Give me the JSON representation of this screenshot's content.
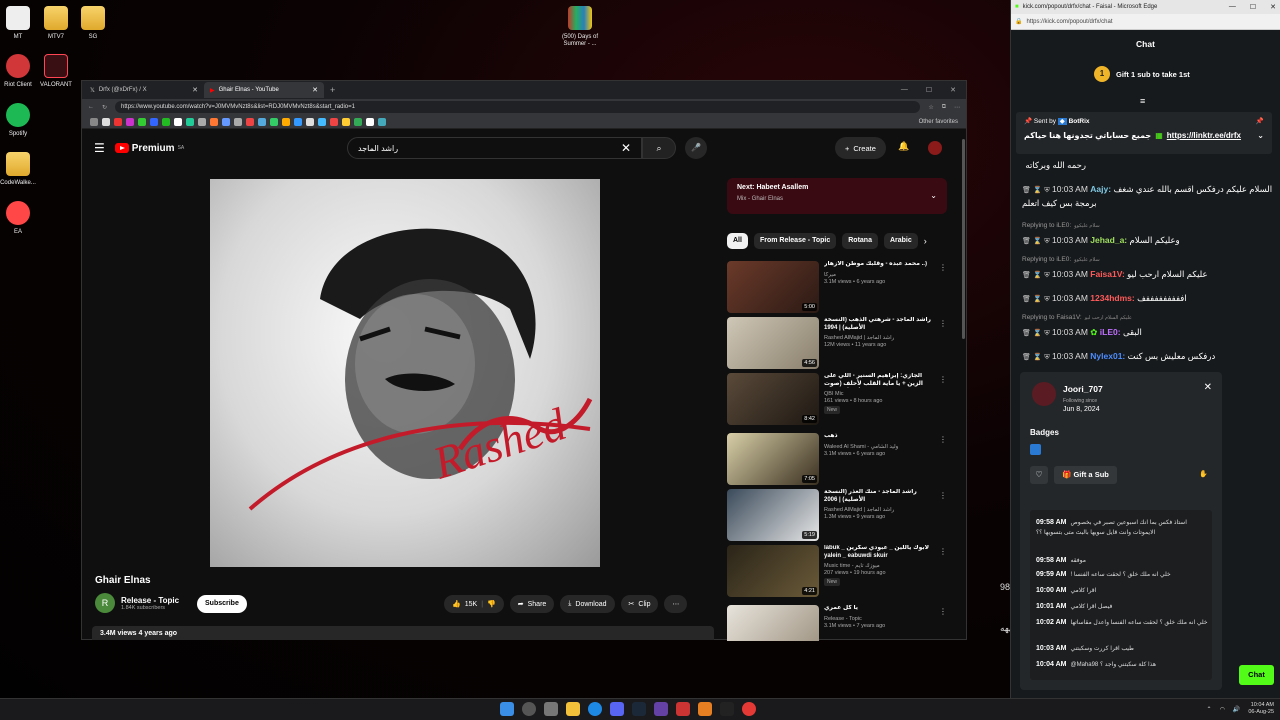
{
  "desktop": {
    "icons": [
      {
        "label": "MT"
      },
      {
        "label": "MTV7"
      },
      {
        "label": "SG"
      },
      {
        "label": "Riot Client"
      },
      {
        "label": "VALORANT"
      },
      {
        "label": "Spotify"
      },
      {
        "label": "CodeWalke..."
      },
      {
        "label": "EA"
      },
      {
        "label": "(500) Days of Summer - ..."
      }
    ],
    "edge_text": [
      "هذا 98",
      "هههه"
    ]
  },
  "browser": {
    "tabs": [
      {
        "label": "Drfx (@xDrFx) / X"
      },
      {
        "label": "Ghair Elnas - YouTube"
      }
    ],
    "url": "https://www.youtube.com/watch?v=J0MVMvNzt8s&list=RDJ0MVMvNzt8s&start_radio=1",
    "other_favorites": "Other favorites"
  },
  "youtube": {
    "logo": "Premium",
    "logo_region": "SA",
    "search_value": "راشد الماجد",
    "create_label": "Create",
    "cover_signature": "Rashed",
    "video_title": "Ghair Elnas",
    "channel_initial": "R",
    "channel_name": "Release - Topic",
    "subscribers": "1.84K subscribers",
    "subscribe_label": "Subscribe",
    "likes": "15K",
    "share_label": "Share",
    "download_label": "Download",
    "clip_label": "Clip",
    "views_line": "3.4M views  4 years ago",
    "up_next_title": "Next: Habeet Asallem",
    "up_next_sub": "Mix - Ghair Elnas",
    "chips": [
      "All",
      "From Release - Topic",
      "Rotana",
      "Arabic"
    ],
    "recommended": [
      {
        "title": "محمد عبده - وقلبك موطن الأزهار ..)",
        "channel": "ميركا",
        "meta": "3.1M views • 6 years ago",
        "duration": "5:00",
        "tag": ""
      },
      {
        "title": "راشد الماجد - شرهتي الذهب (النسخة الأصلية) | 1994",
        "channel": "Rashed AlMajid | راشد الماجد",
        "meta": "12M views • 11 years ago",
        "duration": "4:56",
        "tag": ""
      },
      {
        "title": "الجازي: إبراهيم السنير - اللي على الزين + يا ماية القلب لأحلف (صوت شامي) - سمرة",
        "channel": "QBI Mic",
        "meta": "161 views • 8 hours ago",
        "duration": "8:42",
        "tag": "New"
      },
      {
        "title": "ذهب",
        "channel": "Waleed Al Shami - وليد الشامي",
        "meta": "3.1M views • 6 years ago",
        "duration": "7:05",
        "tag": ""
      },
      {
        "title": "راشد الماجد - منك العذر (النسخة الأصلية) | 2006",
        "channel": "Rashed AlMajid | راشد الماجد",
        "meta": "1.3M views • 9 years ago",
        "duration": "5:19",
        "tag": ""
      },
      {
        "title": "labuk _ لابوك ياللين _ عبودي سكرين yalein _ eabuwdi skuir",
        "channel": "Music time - ميوزك تايم",
        "meta": "207 views • 19 hours ago",
        "duration": "4:21",
        "tag": "New"
      },
      {
        "title": "يا كل عمري",
        "channel": "Release - Topic",
        "meta": "3.1M views • 7 years ago",
        "duration": "",
        "tag": ""
      }
    ]
  },
  "kick": {
    "window_title": "kick.com/popout/drfx/chat - Faisal - Microsoft Edge",
    "url": "https://kick.com/popout/drfx/chat",
    "header": "Chat",
    "gift_text": "Gift 1 sub to take 1st",
    "pinned_sent_by": "Sent by",
    "pinned_bot": "BotRix",
    "pinned_msg": "جميع حساباتي تجدونها هنا حياكم",
    "pinned_link": "https://linktr.ee/drfx",
    "messages": [
      {
        "time": "",
        "user": "",
        "text": "رحمه الله وبركاته",
        "color": "#ffffff"
      },
      {
        "time": "10:03 AM",
        "user": "Aajy:",
        "text": "السلام عليكم درفكس اقسم بالله عندي شغف برمجة بس كيف اتعلم",
        "color": "#7ec8e3"
      },
      {
        "time": "10:03 AM",
        "user": "Jehad_a:",
        "text": "وعليكم السلام",
        "color": "#9fdf5f"
      },
      {
        "time": "10:03 AM",
        "user": "Faisa1V:",
        "text": "عليكم السلام ارحب ليو",
        "color": "#ff5a5a"
      },
      {
        "time": "10:03 AM",
        "user": "1234hdms:",
        "text": "افففففففففف",
        "color": "#ff5a5a"
      },
      {
        "time": "10:03 AM",
        "user": "iLE0:",
        "text": "البقى",
        "color": "#c070ff"
      },
      {
        "time": "10:03 AM",
        "user": "Nylex01:",
        "text": "درفكس معليش بس كنت",
        "color": "#4c8dff"
      }
    ],
    "replies": [
      {
        "label": "Replying to iLE0:",
        "quote": "سلام عليكوو"
      },
      {
        "label": "Replying to iLE0:",
        "quote": "سلام عليكوو"
      },
      {
        "label": "Replying to Faisa1V:",
        "quote": "عليكم السلام ارحب ليو"
      }
    ],
    "card": {
      "username": "Joori_707",
      "following_since": "Following since",
      "date": "Jun 8, 2024",
      "badges": "Badges",
      "gift_sub": "Gift a Sub",
      "history": [
        {
          "time": "09:58 AM",
          "text": "استاذ فكس بما انك اسبوعين تصبر في بخصوص الايموتات وانت قايل سويها بالبث متى بتسويها ؟؟"
        },
        {
          "time": "09:58 AM",
          "text": "موفقه"
        },
        {
          "time": "09:59 AM",
          "text": "! خلي انه ملك خلق ؟ لحقت ساعه الفنسا"
        },
        {
          "time": "10:00 AM",
          "text": "اقرا كلامي"
        },
        {
          "time": "10:01 AM",
          "text": "فيصل اقرا كلامي"
        },
        {
          "time": "10:02 AM",
          "text": "خلي انه ملك خلق ؟ لحقت ساعه الفنسا واعدل مقاساتها"
        },
        {
          "time": "10:03 AM",
          "text": "طيب اقرا كررت وسكبتني"
        },
        {
          "time": "10:04 AM",
          "text": "@Maha98 هذا كلة سكبتني واجد ؟"
        }
      ]
    },
    "chat_button": "Chat"
  },
  "taskbar": {
    "time": "10:04 AM",
    "date": "06-Aug-25"
  }
}
